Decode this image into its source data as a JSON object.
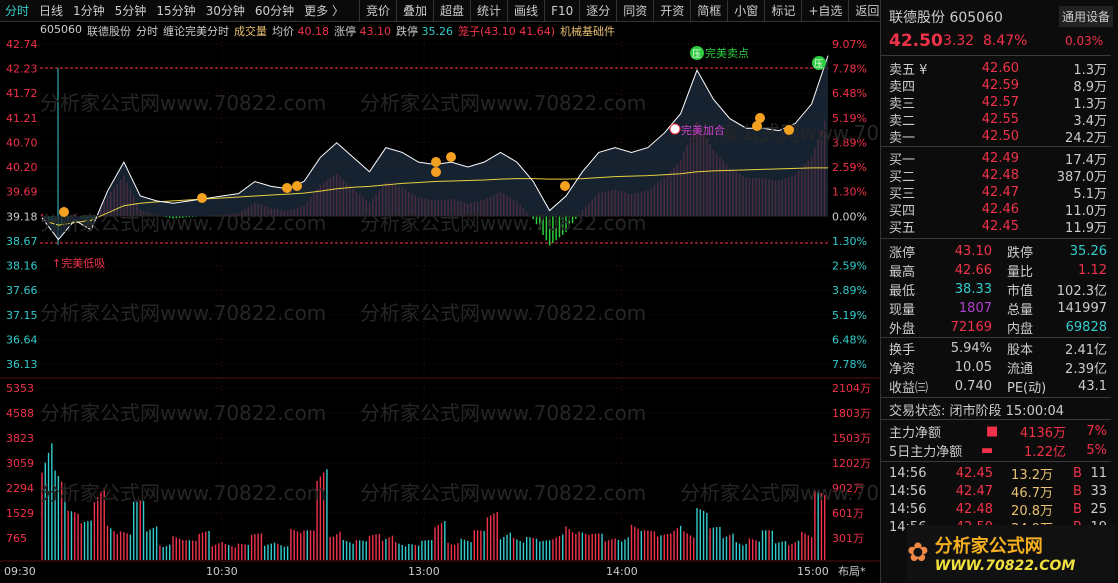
{
  "toolbar": {
    "periods": [
      "分时",
      "日线",
      "1分钟",
      "5分钟",
      "15分钟",
      "30分钟",
      "60分钟",
      "更多 〉"
    ],
    "active": "分时",
    "buttons": [
      "竞价",
      "叠加",
      "超盘",
      "统计",
      "画线",
      "F10",
      "逐分",
      "同资",
      "开资",
      "简框",
      "小窗",
      "标记",
      "+自选",
      "返回"
    ]
  },
  "info": {
    "code": "605060",
    "name": "联德股份",
    "mode": "分时",
    "indicator": "缠论完美分时",
    "volume_label": "成交量",
    "avg_label": "均价",
    "avg": "40.18",
    "limit_up_label": "涨停",
    "limit_up": "43.10",
    "limit_down_label": "跌停",
    "limit_down": "35.26",
    "cage": "笼子(43.10 41.64)",
    "sector": "机械基础件"
  },
  "watermark": "分析家公式网www.70822.com",
  "chart_data": {
    "type": "line",
    "title": "",
    "prev_close": 39.18,
    "price_ticks": [
      "42.74",
      "42.23",
      "41.72",
      "41.21",
      "40.70",
      "40.20",
      "39.69",
      "39.18",
      "38.67",
      "38.16",
      "37.66",
      "37.15",
      "36.64",
      "36.13"
    ],
    "pct_ticks": [
      "9.07%",
      "7.78%",
      "6.48%",
      "5.19%",
      "3.89%",
      "2.59%",
      "1.30%",
      "0.00%",
      "1.30%",
      "2.59%",
      "3.89%",
      "5.19%",
      "6.48%",
      "7.78%"
    ],
    "vol_ticks": [
      "5353",
      "4588",
      "3823",
      "3059",
      "2294",
      "1529",
      "765"
    ],
    "vol_right_ticks": [
      "2104万",
      "1803万",
      "1503万",
      "1202万",
      "902万",
      "601万",
      "301万"
    ],
    "time_ticks": [
      "09:30",
      "10:30",
      "13:00",
      "14:00",
      "15:00"
    ],
    "ylim": [
      36.13,
      42.74
    ],
    "minutes_step": 5,
    "price": [
      39.15,
      38.7,
      39.1,
      38.9,
      39.7,
      40.3,
      39.6,
      39.5,
      39.45,
      39.5,
      39.55,
      39.6,
      39.65,
      39.9,
      39.8,
      39.75,
      39.9,
      40.4,
      40.7,
      40.4,
      40.1,
      40.6,
      40.5,
      40.3,
      40.25,
      40.3,
      40.2,
      40.3,
      40.5,
      40.3,
      39.9,
      39.3,
      39.6,
      40.1,
      40.5,
      40.6,
      40.5,
      40.6,
      40.9,
      41.3,
      42.2,
      41.6,
      41.2,
      41.0,
      41.0,
      40.95,
      41.1,
      41.5,
      42.5
    ],
    "avg": [
      39.1,
      39.0,
      39.05,
      39.1,
      39.25,
      39.4,
      39.45,
      39.48,
      39.5,
      39.52,
      39.54,
      39.56,
      39.58,
      39.6,
      39.62,
      39.64,
      39.66,
      39.7,
      39.75,
      39.78,
      39.8,
      39.83,
      39.86,
      39.88,
      39.9,
      39.91,
      39.92,
      39.93,
      39.95,
      39.96,
      39.96,
      39.95,
      39.95,
      39.96,
      39.98,
      40.0,
      40.01,
      40.02,
      40.04,
      40.06,
      40.1,
      40.12,
      40.13,
      40.14,
      40.15,
      40.16,
      40.17,
      40.18,
      40.18
    ],
    "volume": [
      4800,
      3200,
      1500,
      1200,
      2600,
      1400,
      900,
      1800,
      1100,
      700,
      800,
      600,
      900,
      700,
      600,
      500,
      800,
      600,
      700,
      1000,
      900,
      2900,
      1200,
      700,
      600,
      800,
      900,
      700,
      500,
      600,
      1300,
      800,
      700,
      900,
      1500,
      1100,
      800,
      700,
      600,
      900,
      1400,
      900,
      800,
      700,
      1000,
      1200,
      900,
      800,
      1300,
      1100,
      1600,
      1000,
      900,
      800,
      700,
      900,
      600,
      800,
      1000,
      2100
    ],
    "vol_max": 5353,
    "annotations": [
      {
        "text": "完美低吸",
        "color": "#f2324a"
      },
      {
        "text": "完美加合",
        "color": "#d040d0"
      },
      {
        "text": "完美卖点",
        "color": "#2ecc40"
      }
    ],
    "colors": {
      "up": "#f2324a",
      "down": "#3cc",
      "price": "#ffffff",
      "avg": "#e8d040",
      "neg": "#2ecc40"
    }
  },
  "layout_label": "布局*",
  "panel": {
    "name": "联德股份 605060",
    "device": "通用设备",
    "device_pct": "0.03%",
    "price": "42.50",
    "change": "3.32",
    "pct": "8.47%",
    "asks": [
      {
        "l": "卖五 ¥",
        "p": "42.60",
        "v": "1.3万"
      },
      {
        "l": "卖四",
        "p": "42.59",
        "v": "8.9万"
      },
      {
        "l": "卖三",
        "p": "42.57",
        "v": "1.3万"
      },
      {
        "l": "卖二",
        "p": "42.55",
        "v": "3.4万"
      },
      {
        "l": "卖一",
        "p": "42.50",
        "v": "24.2万"
      }
    ],
    "bids": [
      {
        "l": "买一",
        "p": "42.49",
        "v": "17.4万"
      },
      {
        "l": "买二",
        "p": "42.48",
        "v": "387.0万"
      },
      {
        "l": "买三",
        "p": "42.47",
        "v": "5.1万"
      },
      {
        "l": "买四",
        "p": "42.46",
        "v": "11.0万"
      },
      {
        "l": "买五",
        "p": "42.45",
        "v": "11.9万"
      }
    ],
    "stats": [
      [
        "涨停",
        "43.10",
        "r",
        "跌停",
        "35.26",
        "c"
      ],
      [
        "最高",
        "42.66",
        "r",
        "量比",
        "1.12",
        "r"
      ],
      [
        "最低",
        "38.33",
        "c",
        "市值",
        "102.3亿",
        "w"
      ],
      [
        "现量",
        "1807",
        "m",
        "总量",
        "141997",
        "w"
      ],
      [
        "外盘",
        "72169",
        "r",
        "内盘",
        "69828",
        "c"
      ]
    ],
    "stats2": [
      [
        "换手",
        "5.94%",
        "股本",
        "2.41亿"
      ],
      [
        "净资",
        "10.05",
        "流通",
        "2.39亿"
      ],
      [
        "收益㈢",
        "0.740",
        "PE(动)",
        "43.1"
      ]
    ],
    "status": "交易状态: 闭市阶段 15:00:04",
    "flows": [
      {
        "l": "主力净额",
        "v": "4136万",
        "p": "7%"
      },
      {
        "l": "5日主力净额",
        "v": "1.22亿",
        "p": "5%"
      }
    ],
    "trades": [
      {
        "t": "14:56",
        "p": "42.45",
        "v": "13.2万",
        "s": "B",
        "n": "11"
      },
      {
        "t": "14:56",
        "p": "42.47",
        "v": "46.7万",
        "s": "B",
        "n": "33"
      },
      {
        "t": "14:56",
        "p": "42.48",
        "v": "20.8万",
        "s": "B",
        "n": "25"
      },
      {
        "t": "14:56",
        "p": "42.50",
        "v": "34.9万",
        "s": "B",
        "n": "19"
      }
    ]
  },
  "logo": {
    "title": "分析家公式网",
    "url": "WWW.70822.COM"
  }
}
